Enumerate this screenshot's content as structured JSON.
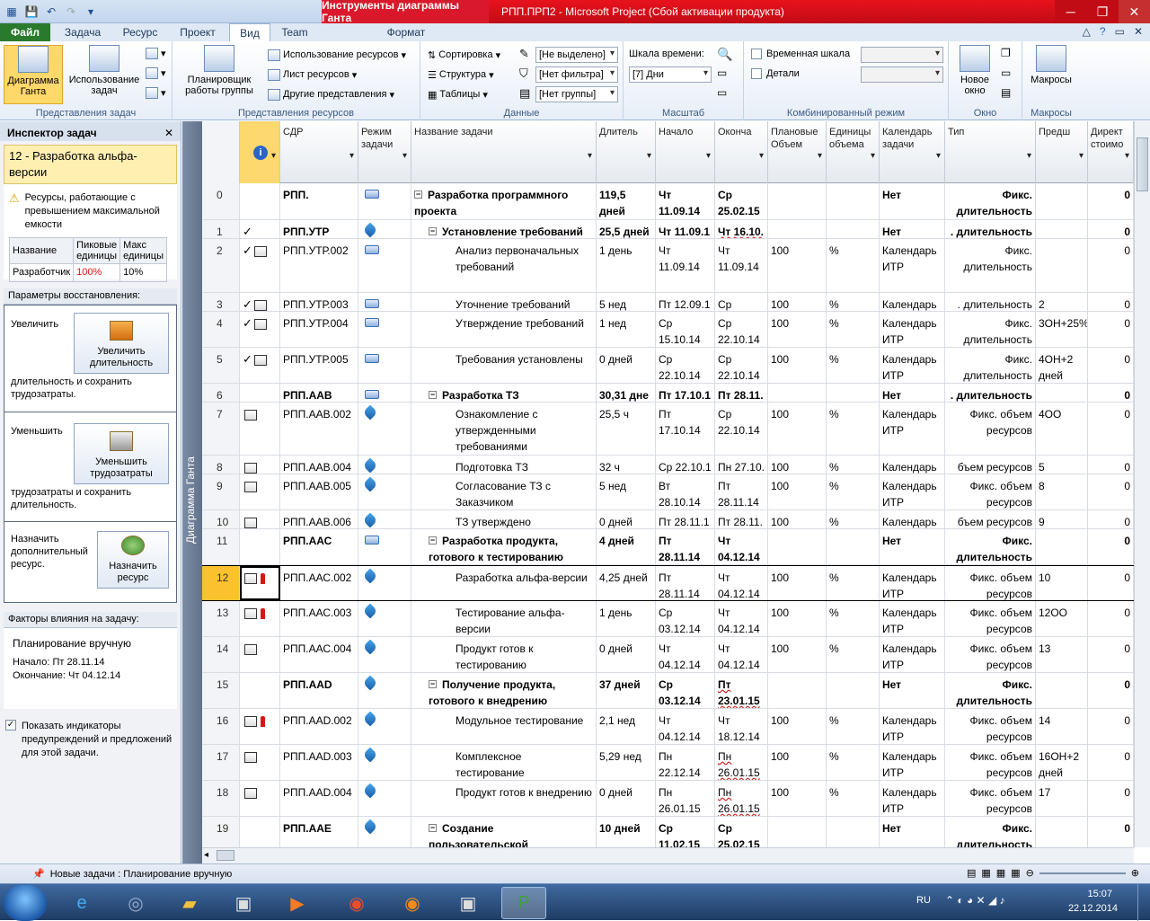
{
  "window": {
    "tools_tab": "Инструменты диаграммы Ганта",
    "title": "РПП.ПРП2  -  Microsoft Project (Сбой активации продукта)"
  },
  "tabs": [
    "Файл",
    "Задача",
    "Ресурс",
    "Проект",
    "Вид",
    "Team",
    "Формат"
  ],
  "ribbon": {
    "groups": [
      "Представления задач",
      "Представления ресурсов",
      "Данные",
      "Масштаб",
      "Комбинированный режим",
      "Окно",
      "Макросы"
    ],
    "gantt": "Диаграмма Ганта",
    "task_usage": "Использование задач",
    "team_planner": "Планировщик работы группы",
    "res_usage": "Использование ресурсов",
    "res_sheet": "Лист ресурсов",
    "other_views": "Другие представления",
    "sort": "Сортировка",
    "outline": "Структура",
    "tables": "Таблицы",
    "highlight": "[Не выделено]",
    "filter": "[Нет фильтра]",
    "group": "[Нет группы]",
    "timescale_label": "Шкала времени:",
    "timescale": "[7] Дни",
    "timeline": "Временная шкала",
    "details": "Детали",
    "new_window": "Новое окно",
    "macros": "Макросы"
  },
  "inspector": {
    "title": "Инспектор задач",
    "task": "12 - Разработка альфа-версии",
    "warning": "Ресурсы, работающие с превышением максимальной емкости",
    "col1": "Название",
    "col2": "Пиковые единицы",
    "col3": "Макс единицы",
    "res_name": "Разработчик",
    "res_peak": "100%",
    "res_max": "10%",
    "repair_title": "Параметры восстановления:",
    "inc_label": "Увеличить",
    "inc_btn": "Увеличить длительность",
    "inc_text": "длительность и сохранить трудозатраты.",
    "dec_label": "Уменьшить",
    "dec_btn": "Уменьшить трудозатраты",
    "dec_text": "трудозатраты и сохранить длительность.",
    "assign_label": "Назначить дополнительный ресурс.",
    "assign_btn": "Назначить ресурс",
    "factors_title": "Факторы влияния на задачу:",
    "factor1": "Планирование вручную",
    "factor2": "Начало: Пт 28.11.14",
    "factor3": "Окончание: Чт 04.12.14",
    "show_ind": "Показать индикаторы предупреждений и предложений для этой задачи."
  },
  "view_bar": "Диаграмма Ганта",
  "headers": [
    "",
    "СДР",
    "Режим задачи",
    "Название задачи",
    "Длитель",
    "Начало",
    "Оконча",
    "Плановые Объем",
    "Единицы объема",
    "Календарь задачи",
    "Тип",
    "Предш",
    "Директ стоимо"
  ],
  "rows": [
    {
      "id": "0",
      "wbs": "РПП.",
      "name": "Разработка программного проекта",
      "dur": "119,5 дней",
      "start": "Чт 11.09.14",
      "finish": "Ср 25.02.15",
      "cal": "Нет",
      "type": "Фикс. длительность",
      "pred": "",
      "cost": "0",
      "bold": true,
      "lvl": 0,
      "sum": true,
      "mode": "auto",
      "ind": "",
      "h": 41
    },
    {
      "id": "1",
      "wbs": "РПП.УТР",
      "name": "Установление требований",
      "dur": "25,5 дней",
      "start": "Чт 11.09.1",
      "finish": "Чт 16.10.",
      "cal": "Нет",
      "type": ". длительность",
      "pred": "",
      "cost": "0",
      "bold": true,
      "lvl": 1,
      "sum": true,
      "mode": "pin",
      "ind": "check",
      "h": 21
    },
    {
      "id": "2",
      "wbs": "РПП.УТР.002",
      "name": "Анализ первоначальных требований",
      "dur": "1 день",
      "start": "Чт 11.09.14",
      "finish": "Чт 11.09.14",
      "plan": "100",
      "unit": "%",
      "cal": "Календарь ИТР",
      "type": "Фикс. длительность",
      "pred": "",
      "cost": "0",
      "lvl": 2,
      "mode": "auto",
      "ind": "checkicon",
      "h": 60
    },
    {
      "id": "3",
      "wbs": "РПП.УТР.003",
      "name": "Уточнение требований",
      "dur": "5 нед",
      "start": "Пт 12.09.1",
      "finish": "Ср 15.10.",
      "plan": "100",
      "unit": "%",
      "cal": "Календарь",
      "type": ". длительность",
      "pred": "2",
      "cost": "0",
      "lvl": 2,
      "mode": "auto",
      "ind": "checkicon",
      "h": 21
    },
    {
      "id": "4",
      "wbs": "РПП.УТР.004",
      "name": "Утверждение требований",
      "dur": "1 нед",
      "start": "Ср 15.10.14",
      "finish": "Ср 22.10.14",
      "plan": "100",
      "unit": "%",
      "cal": "Календарь ИТР",
      "type": "Фикс. длительность",
      "pred": "3ОН+25%",
      "cost": "0",
      "lvl": 2,
      "mode": "auto",
      "ind": "checkicon",
      "h": 40
    },
    {
      "id": "5",
      "wbs": "РПП.УТР.005",
      "name": "Требования установлены",
      "dur": "0 дней",
      "start": "Ср 22.10.14",
      "finish": "Ср 22.10.14",
      "plan": "100",
      "unit": "%",
      "cal": "Календарь ИТР",
      "type": "Фикс. длительность",
      "pred": "4ОН+2 дней",
      "cost": "0",
      "lvl": 2,
      "mode": "auto",
      "ind": "checkicon",
      "h": 40
    },
    {
      "id": "6",
      "wbs": "РПП.ААВ",
      "name": "Разработка ТЗ",
      "dur": "30,31 дне",
      "start": "Пт 17.10.1",
      "finish": "Пт 28.11.",
      "cal": "Нет",
      "type": ". длительность",
      "pred": "",
      "cost": "0",
      "bold": true,
      "lvl": 1,
      "sum": true,
      "mode": "auto",
      "ind": "",
      "h": 21
    },
    {
      "id": "7",
      "wbs": "РПП.ААВ.002",
      "name": "Ознакомление с утвержденными требованиями",
      "dur": "25,5 ч",
      "start": "Пт 17.10.14",
      "finish": "Ср 22.10.14",
      "plan": "100",
      "unit": "%",
      "cal": "Календарь ИТР",
      "type": "Фикс. объем ресурсов",
      "pred": "4ОО",
      "cost": "0",
      "lvl": 2,
      "mode": "pin",
      "ind": "icon",
      "h": 59
    },
    {
      "id": "8",
      "wbs": "РПП.ААВ.004",
      "name": "Подготовка ТЗ",
      "dur": "32 ч",
      "start": "Ср 22.10.1",
      "finish": "Пн 27.10.",
      "plan": "100",
      "unit": "%",
      "cal": "Календарь",
      "type": "бъем ресурсов",
      "pred": "5",
      "cost": "0",
      "lvl": 2,
      "mode": "pin",
      "ind": "icon",
      "h": 21
    },
    {
      "id": "9",
      "wbs": "РПП.ААВ.005",
      "name": "Согласование ТЗ с Заказчиком",
      "dur": "5 нед",
      "start": "Вт 28.10.14",
      "finish": "Пт 28.11.14",
      "plan": "100",
      "unit": "%",
      "cal": "Календарь ИТР",
      "type": "Фикс. объем ресурсов",
      "pred": "8",
      "cost": "0",
      "lvl": 2,
      "mode": "pin",
      "ind": "icon",
      "h": 40
    },
    {
      "id": "10",
      "wbs": "РПП.ААВ.006",
      "name": "ТЗ утверждено",
      "dur": "0 дней",
      "start": "Пт 28.11.1",
      "finish": "Пт 28.11.",
      "plan": "100",
      "unit": "%",
      "cal": "Календарь",
      "type": "бъем ресурсов",
      "pred": "9",
      "cost": "0",
      "lvl": 2,
      "mode": "pin",
      "ind": "icon",
      "h": 21
    },
    {
      "id": "11",
      "wbs": "РПП.ААС",
      "name": "Разработка продукта, готового к тестированию",
      "dur": "4 дней",
      "start": "Пт 28.11.14",
      "finish": "Чт 04.12.14",
      "cal": "Нет",
      "type": "Фикс. длительность",
      "pred": "",
      "cost": "0",
      "bold": true,
      "lvl": 1,
      "sum": true,
      "mode": "auto",
      "ind": "",
      "h": 40
    },
    {
      "id": "12",
      "wbs": "РПП.ААС.002",
      "name": "Разработка альфа-версии",
      "dur": "4,25 дней",
      "start": "Пт 28.11.14",
      "finish": "Чт 04.12.14",
      "plan": "100",
      "unit": "%",
      "cal": "Календарь ИТР",
      "type": "Фикс. объем ресурсов",
      "pred": "10",
      "cost": "0",
      "lvl": 2,
      "mode": "pin",
      "ind": "iconman",
      "h": 40,
      "sel": true
    },
    {
      "id": "13",
      "wbs": "РПП.ААС.003",
      "name": "Тестирование альфа-версии",
      "dur": "1 день",
      "start": "Ср 03.12.14",
      "finish": "Чт 04.12.14",
      "plan": "100",
      "unit": "%",
      "cal": "Календарь ИТР",
      "type": "Фикс. объем ресурсов",
      "pred": "12ОО",
      "cost": "0",
      "lvl": 2,
      "mode": "pin",
      "ind": "iconman",
      "h": 40
    },
    {
      "id": "14",
      "wbs": "РПП.ААС.004",
      "name": "Продукт готов к тестированию",
      "dur": "0 дней",
      "start": "Чт 04.12.14",
      "finish": "Чт 04.12.14",
      "plan": "100",
      "unit": "%",
      "cal": "Календарь ИТР",
      "type": "Фикс. объем ресурсов",
      "pred": "13",
      "cost": "0",
      "lvl": 2,
      "mode": "pin",
      "ind": "icon",
      "h": 40
    },
    {
      "id": "15",
      "wbs": "РПП.AAD",
      "name": "Получение продукта, готового к внедрению",
      "dur": "37 дней",
      "start": "Ср 03.12.14",
      "finish": "Пт 23.01.15",
      "cal": "Нет",
      "type": "Фикс. длительность",
      "pred": "",
      "cost": "0",
      "bold": true,
      "lvl": 1,
      "sum": true,
      "mode": "pin",
      "ind": "",
      "h": 40,
      "ulfinish": true
    },
    {
      "id": "16",
      "wbs": "РПП.AAD.002",
      "name": "Модульное тестирование",
      "dur": "2,1 нед",
      "start": "Чт 04.12.14",
      "finish": "Чт 18.12.14",
      "plan": "100",
      "unit": "%",
      "cal": "Календарь ИТР",
      "type": "Фикс. объем ресурсов",
      "pred": "14",
      "cost": "0",
      "lvl": 2,
      "mode": "pin",
      "ind": "iconman",
      "h": 40
    },
    {
      "id": "17",
      "wbs": "РПП.AAD.003",
      "name": "Комплексное тестирование",
      "dur": "5,29 нед",
      "start": "Пн 22.12.14",
      "finish": "Пн 26.01.15",
      "plan": "100",
      "unit": "%",
      "cal": "Календарь ИТР",
      "type": "Фикс. объем ресурсов",
      "pred": "16ОН+2 дней",
      "cost": "0",
      "lvl": 2,
      "mode": "pin",
      "ind": "icon",
      "h": 40,
      "ulfinish": true
    },
    {
      "id": "18",
      "wbs": "РПП.AAD.004",
      "name": "Продукт готов к внедрению",
      "dur": "0 дней",
      "start": "Пн 26.01.15",
      "finish": "Пн 26.01.15",
      "plan": "100",
      "unit": "%",
      "cal": "Календарь ИТР",
      "type": "Фикс. объем ресурсов",
      "pred": "17",
      "cost": "0",
      "lvl": 2,
      "mode": "pin",
      "ind": "icon",
      "h": 40,
      "ulfinish": true
    },
    {
      "id": "19",
      "wbs": "РПП.ААЕ",
      "name": "Создание пользовательской",
      "dur": "10 дней",
      "start": "Ср 11.02.15",
      "finish": "Ср 25.02.15",
      "cal": "Нет",
      "type": "Фикс. длительность",
      "pred": "",
      "cost": "0",
      "bold": true,
      "lvl": 1,
      "sum": true,
      "mode": "pin",
      "ind": "",
      "h": 40
    }
  ],
  "status": {
    "new_tasks": "Новые задачи : Планирование вручную"
  },
  "tray": {
    "lang": "RU",
    "time": "15:07",
    "date": "22.12.2014"
  }
}
